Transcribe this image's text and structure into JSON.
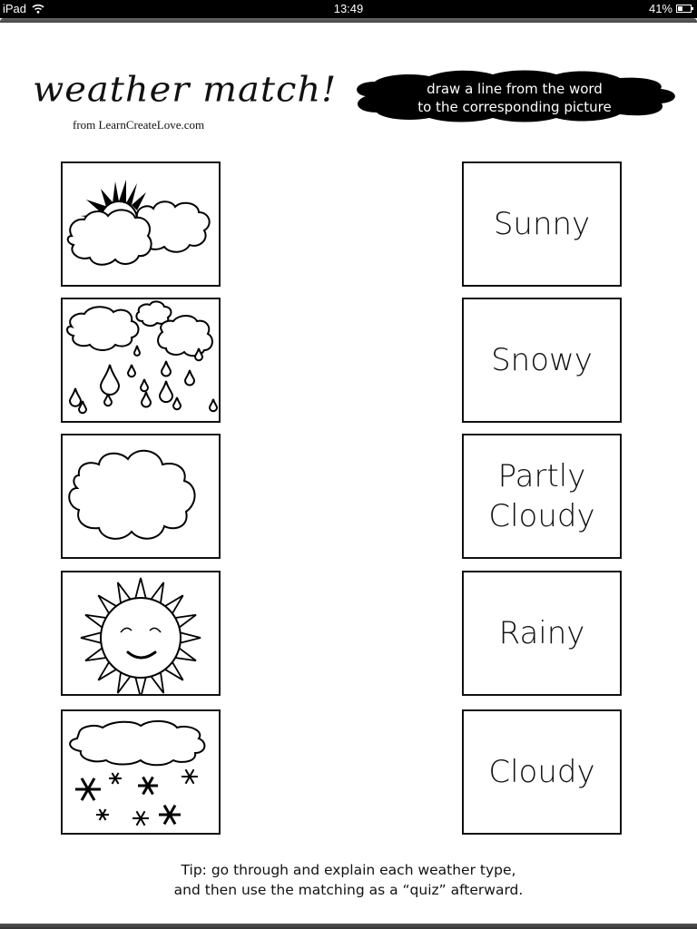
{
  "status_bar": {
    "device": "iPad",
    "time": "13:49",
    "battery_percent": "41%",
    "battery_level": 0.41,
    "icons": [
      "wifi-icon",
      "battery-icon"
    ]
  },
  "worksheet": {
    "title": "weather match!",
    "source": "from LearnCreateLove.com",
    "instruction_line1": "draw a line from the word",
    "instruction_line2": "to the corresponding picture",
    "pictures": [
      {
        "icon": "partly-cloudy-icon"
      },
      {
        "icon": "rainy-icon"
      },
      {
        "icon": "cloudy-icon"
      },
      {
        "icon": "sunny-icon"
      },
      {
        "icon": "snowy-icon"
      }
    ],
    "words": [
      "Sunny",
      "Snowy",
      "Partly\nCloudy",
      "Rainy",
      "Cloudy"
    ],
    "tip_line1": "Tip: go through and explain each weather type,",
    "tip_line2": "and then use the matching as a “quiz” afterward."
  }
}
